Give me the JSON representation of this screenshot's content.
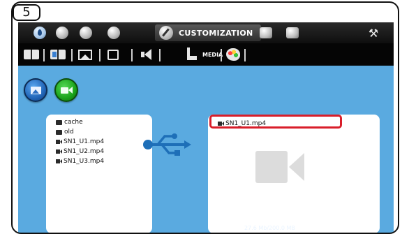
{
  "step_badge": "5",
  "topbar": {
    "active_tab_label": "CUSTOMIZATION",
    "icons": [
      "water-drop-icon",
      "clock-icon",
      "display-icon",
      "info-icon",
      "pen-icon",
      "calendar-icon",
      "user-icon",
      "wrench-icon"
    ]
  },
  "subbar": {
    "media_label": "MEDIA",
    "icons": [
      "book-icon",
      "blue-book-icon",
      "picture-icon",
      "screensaver-icon",
      "speaker-icon",
      "media-icon",
      "palette-icon"
    ]
  },
  "left_panel": {
    "files": [
      {
        "type": "folder",
        "name": "cache"
      },
      {
        "type": "folder",
        "name": "old"
      },
      {
        "type": "video",
        "name": "SN1_U1.mp4"
      },
      {
        "type": "video",
        "name": "SN1_U2.mp4"
      },
      {
        "type": "video",
        "name": "SN1_U3.mp4"
      }
    ]
  },
  "right_panel": {
    "files": [
      {
        "type": "video",
        "name": "SN1_U1.mp4"
      }
    ],
    "highlight_color": "#d91e2a"
  },
  "storage": "27.6 Mb/200.0 MB",
  "colors": {
    "main_bg": "#5aaae0",
    "photo_button": "#2266b8",
    "video_button": "#1aa31a",
    "usb_symbol": "#1e6fb8"
  }
}
